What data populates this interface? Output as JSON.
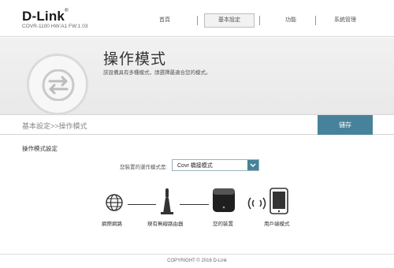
{
  "header": {
    "brand": "D-Link",
    "model_info": "COVR-1100 HW:A1 FW:1.03",
    "nav": [
      {
        "label": "首頁",
        "active": false
      },
      {
        "label": "基本設定",
        "active": true
      },
      {
        "label": "功能",
        "active": false
      },
      {
        "label": "系統管理",
        "active": false
      }
    ]
  },
  "banner": {
    "icon": "swap-arrows-icon",
    "title": "操作模式",
    "description": "該設備具有多種模式，請選擇最適合您的模式。"
  },
  "breadcrumb": "基本設定>>操作模式",
  "save_label": "儲存",
  "section": {
    "title": "操作模式設定",
    "mode_label": "您裝置的運作模式是:",
    "mode_value": "Covr 橋接模式"
  },
  "diagram": {
    "internet": "網際網路",
    "router": "現有無線路由器",
    "device": "您的裝置",
    "client": "用戶端模式"
  },
  "footer": "COPYRIGHT © 2016 D-Link",
  "colors": {
    "accent": "#46839a",
    "banner_bg": "#ececec"
  }
}
